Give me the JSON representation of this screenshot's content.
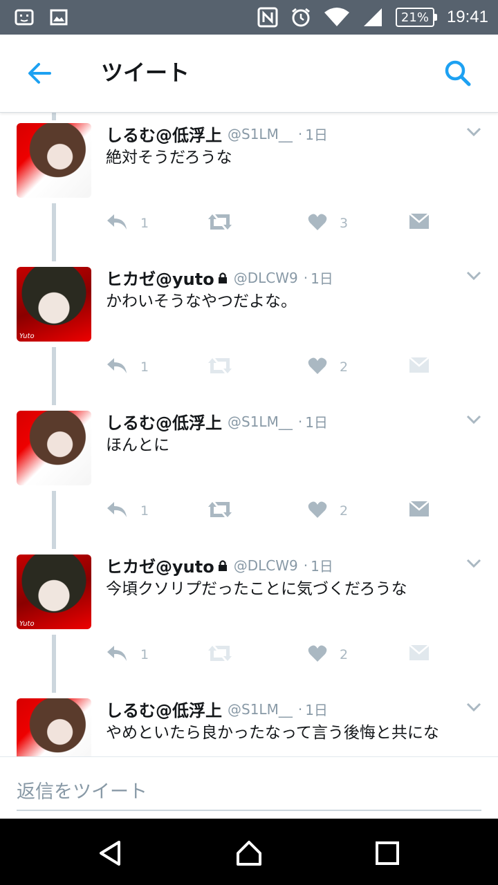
{
  "status_bar": {
    "time": "19:41",
    "battery": "21%",
    "left_icons": [
      "notification-icon",
      "image-icon"
    ],
    "right_icons": [
      "nfc-icon",
      "alarm-icon",
      "wifi-icon",
      "signal-icon"
    ]
  },
  "header": {
    "title": "ツイート",
    "back_icon": "arrow-left-icon",
    "search_icon": "search-icon",
    "accent_color": "#1da1f2"
  },
  "tweets": [
    {
      "name": "しるむ@低浮上",
      "locked": false,
      "handle": "@S1LM__",
      "dot": "·",
      "time": "1日",
      "text": "絶対そうだろうな",
      "reply_count": "1",
      "retweet_count": "",
      "like_count": "3",
      "avatar": "a1",
      "dm_active": true
    },
    {
      "name": "ヒカゼ@yuto",
      "locked": true,
      "handle": "@DLCW9",
      "dot": "·",
      "time": "1日",
      "text": "かわいそうなやつだよな。",
      "reply_count": "1",
      "retweet_count": "",
      "like_count": "2",
      "avatar": "a2",
      "dm_active": false
    },
    {
      "name": "しるむ@低浮上",
      "locked": false,
      "handle": "@S1LM__",
      "dot": "·",
      "time": "1日",
      "text": "ほんとに",
      "reply_count": "1",
      "retweet_count": "",
      "like_count": "2",
      "avatar": "a1",
      "dm_active": true
    },
    {
      "name": "ヒカゼ@yuto",
      "locked": true,
      "handle": "@DLCW9",
      "dot": "·",
      "time": "1日",
      "text": "今頃クソリプだったことに気づくだろうな",
      "reply_count": "1",
      "retweet_count": "",
      "like_count": "2",
      "avatar": "a2",
      "dm_active": false
    },
    {
      "name": "しるむ@低浮上",
      "locked": false,
      "handle": "@S1LM__",
      "dot": "·",
      "time": "1日",
      "text": "やめといたら良かったなって言う後悔と共にな",
      "reply_count": "",
      "retweet_count": "",
      "like_count": "",
      "avatar": "a1",
      "dm_active": true
    }
  ],
  "avatar_tag": "Yuto",
  "reply_bar": {
    "placeholder": "返信をツイート"
  },
  "nav_bar": {
    "back_icon": "triangle-back-icon",
    "home_icon": "home-icon",
    "recents_icon": "square-recents-icon"
  }
}
